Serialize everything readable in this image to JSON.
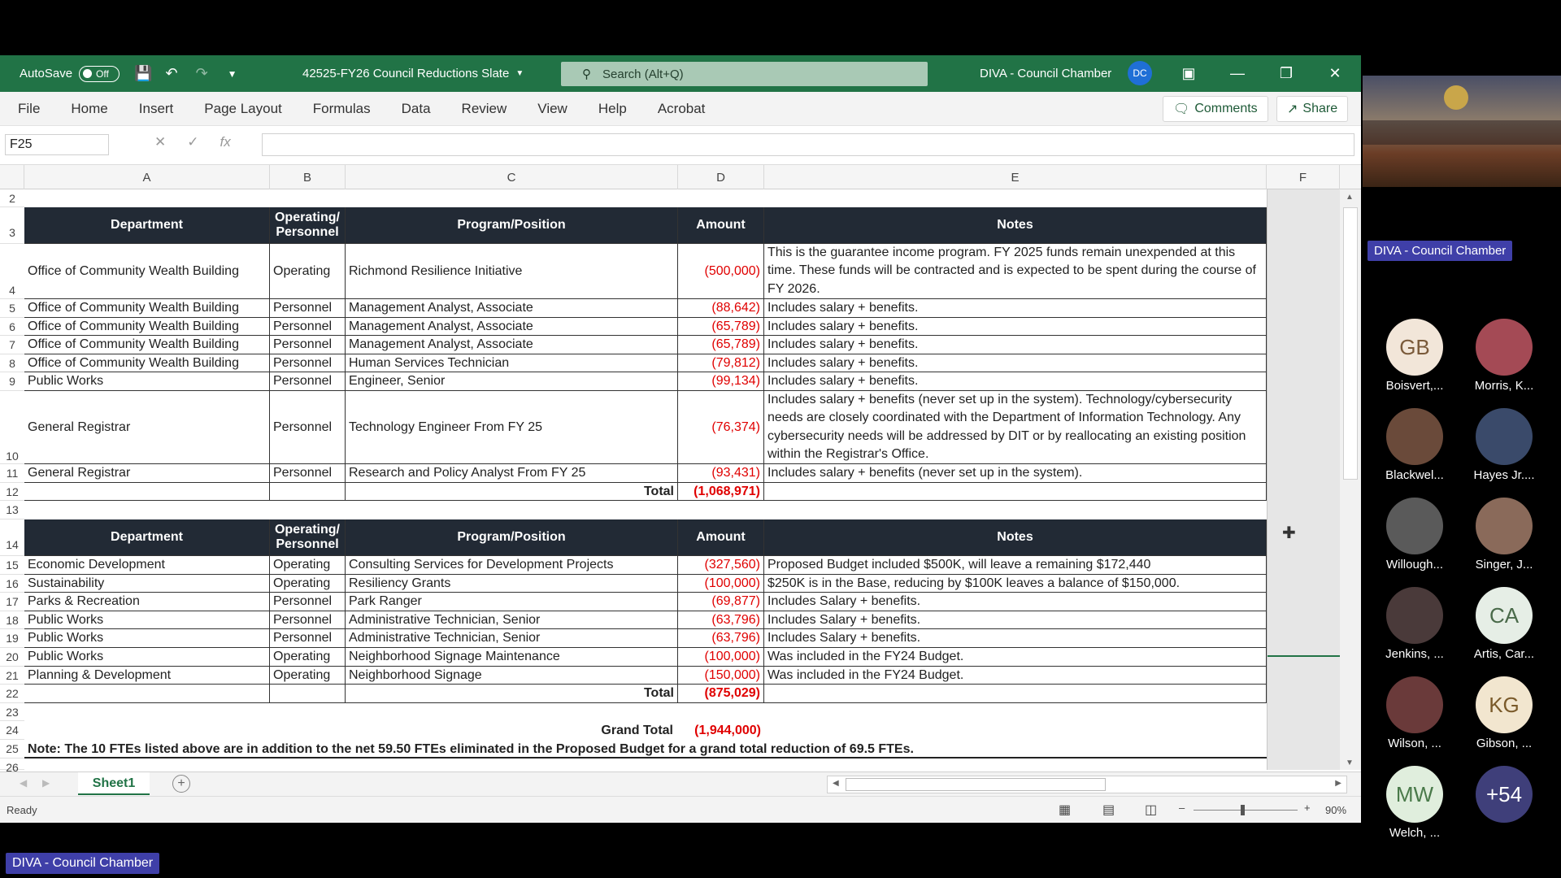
{
  "titlebar": {
    "autosave_label": "AutoSave",
    "autosave_state": "Off",
    "filename": "42525-FY26 Council Reductions Slate",
    "search_placeholder": "Search (Alt+Q)",
    "account_name": "DIVA - Council Chamber",
    "account_initials": "DC"
  },
  "menu": [
    "File",
    "Home",
    "Insert",
    "Page Layout",
    "Formulas",
    "Data",
    "Review",
    "View",
    "Help",
    "Acrobat"
  ],
  "actions": {
    "comments": "Comments",
    "share": "Share"
  },
  "namebox": "F25",
  "columns": [
    "A",
    "B",
    "C",
    "D",
    "E",
    "F"
  ],
  "table1": {
    "headers": [
      "Department",
      "Operating/ Personnel",
      "Program/Position",
      "Amount",
      "Notes"
    ],
    "rows": [
      [
        "Office of Community Wealth Building",
        "Operating",
        "Richmond Resilience Initiative",
        "(500,000)",
        "This is the guarantee income program. FY 2025 funds remain unexpended at this time. These funds will be contracted and is expected to be spent during the course of FY 2026."
      ],
      [
        "Office of Community Wealth Building",
        "Personnel",
        "Management Analyst, Associate",
        "(88,642)",
        "Includes salary + benefits."
      ],
      [
        "Office of Community Wealth Building",
        "Personnel",
        "Management Analyst, Associate",
        "(65,789)",
        "Includes salary + benefits."
      ],
      [
        "Office of Community Wealth Building",
        "Personnel",
        "Management Analyst, Associate",
        "(65,789)",
        "Includes salary + benefits."
      ],
      [
        "Office of Community Wealth Building",
        "Personnel",
        "Human Services Technician",
        "(79,812)",
        "Includes salary + benefits."
      ],
      [
        "Public Works",
        "Personnel",
        "Engineer, Senior",
        "(99,134)",
        "Includes salary + benefits."
      ],
      [
        "General Registrar",
        "Personnel",
        "Technology Engineer From FY 25",
        "(76,374)",
        "Includes salary + benefits (never set up in the system). Technology/cybersecurity needs are closely coordinated with the Department of Information Technology. Any cybersecurity needs will be addressed by DIT or by reallocating an existing position within the Registrar's Office."
      ],
      [
        "General Registrar",
        "Personnel",
        "Research and Policy Analyst From FY 25",
        "(93,431)",
        "Includes salary + benefits (never set up in the system)."
      ]
    ],
    "total_label": "Total",
    "total": "(1,068,971)"
  },
  "table2": {
    "headers": [
      "Department",
      "Operating/ Personnel",
      "Program/Position",
      "Amount",
      "Notes"
    ],
    "rows": [
      [
        "Economic Development",
        "Operating",
        "Consulting Services for Development Projects",
        "(327,560)",
        "Proposed Budget included $500K, will leave a remaining $172,440"
      ],
      [
        "Sustainability",
        "Operating",
        "Resiliency Grants",
        "(100,000)",
        "$250K is in the Base, reducing by $100K leaves a balance of $150,000."
      ],
      [
        "Parks & Recreation",
        "Personnel",
        "Park Ranger",
        "(69,877)",
        "Includes Salary + benefits."
      ],
      [
        "Public Works",
        "Personnel",
        "Administrative Technician, Senior",
        "(63,796)",
        "Includes Salary + benefits."
      ],
      [
        "Public Works",
        "Personnel",
        "Administrative Technician, Senior",
        "(63,796)",
        "Includes Salary + benefits."
      ],
      [
        "Public Works",
        "Operating",
        "Neighborhood Signage Maintenance",
        "(100,000)",
        "Was included in the FY24 Budget."
      ],
      [
        "Planning & Development",
        "Operating",
        "Neighborhood Signage",
        "(150,000)",
        "Was included in the FY24 Budget."
      ]
    ],
    "total_label": "Total",
    "total": "(875,029)"
  },
  "grand_total_label": "Grand Total",
  "grand_total": "(1,944,000)",
  "note": "Note: The 10 FTEs listed above are in addition to the net 59.50 FTEs eliminated in the Proposed Budget for a grand total reduction of 69.5 FTEs.",
  "row_numbers": [
    "2",
    "3",
    "4",
    "5",
    "6",
    "7",
    "8",
    "9",
    "10",
    "11",
    "12",
    "13",
    "14",
    "15",
    "16",
    "17",
    "18",
    "19",
    "20",
    "21",
    "22",
    "23",
    "24",
    "25",
    "26"
  ],
  "sheet_tab": "Sheet1",
  "status": "Ready",
  "zoom": "90%",
  "meeting": {
    "room_label": "DIVA - Council Chamber",
    "participants": [
      {
        "name": "Boisvert,...",
        "initials": "GB",
        "color": "#f2e6d9",
        "text_color": "#7a5a3a"
      },
      {
        "name": "Morris, K...",
        "initials": "",
        "color": "#a44a55",
        "text_color": "#fff"
      },
      {
        "name": "Blackwel...",
        "initials": "",
        "color": "#6a4a3a",
        "text_color": "#fff"
      },
      {
        "name": "Hayes Jr....",
        "initials": "",
        "color": "#3a4a6a",
        "text_color": "#fff"
      },
      {
        "name": "Willough...",
        "initials": "",
        "color": "#5a5a5a",
        "text_color": "#fff"
      },
      {
        "name": "Singer, J...",
        "initials": "",
        "color": "#8a6a5a",
        "text_color": "#fff"
      },
      {
        "name": "Jenkins, ...",
        "initials": "",
        "color": "#4a3a3a",
        "text_color": "#fff"
      },
      {
        "name": "Artis, Car...",
        "initials": "CA",
        "color": "#e6eee6",
        "text_color": "#4a6a4a"
      },
      {
        "name": "Wilson, ...",
        "initials": "",
        "color": "#6a3a3a",
        "text_color": "#fff"
      },
      {
        "name": "Gibson, ...",
        "initials": "KG",
        "color": "#f2e6cf",
        "text_color": "#7a5a2a"
      },
      {
        "name": "Welch, ...",
        "initials": "MW",
        "color": "#e0eedd",
        "text_color": "#4a7a4a"
      },
      {
        "name": "",
        "initials": "+54",
        "color": "#3f3f7a",
        "text_color": "#fff"
      }
    ]
  },
  "bottom_label": "DIVA - Council Chamber"
}
